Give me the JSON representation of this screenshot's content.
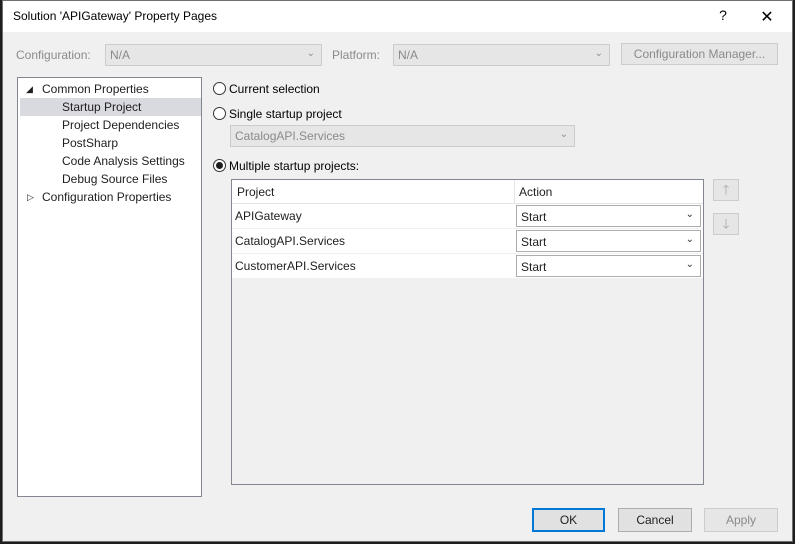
{
  "window": {
    "title": "Solution 'APIGateway' Property Pages",
    "help_glyph": "?",
    "close_glyph": "✕"
  },
  "top_bar": {
    "configuration_label": "Configuration:",
    "configuration_value": "N/A",
    "platform_label": "Platform:",
    "platform_value": "N/A",
    "configuration_manager_label": "Configuration Manager..."
  },
  "tree": {
    "common_properties": "Common Properties",
    "items": [
      "Startup Project",
      "Project Dependencies",
      "PostSharp",
      "Code Analysis Settings",
      "Debug Source Files"
    ],
    "configuration_properties": "Configuration Properties",
    "selected_index": 0
  },
  "startup": {
    "current_selection_label": "Current selection",
    "single_label": "Single startup project",
    "single_value": "CatalogAPI.Services",
    "multiple_label": "Multiple startup projects:",
    "selected_option": "multiple"
  },
  "grid": {
    "columns": [
      "Project",
      "Action"
    ],
    "rows": [
      {
        "project": "APIGateway",
        "action": "Start"
      },
      {
        "project": "CatalogAPI.Services",
        "action": "Start"
      },
      {
        "project": "CustomerAPI.Services",
        "action": "Start"
      }
    ]
  },
  "move_buttons": {
    "up_glyph": "🡑",
    "down_glyph": "🡓"
  },
  "footer": {
    "ok_label": "OK",
    "cancel_label": "Cancel",
    "apply_label": "Apply"
  },
  "icons": {
    "chevron": "⌄",
    "expanded": "◢",
    "collapsed": "▷"
  },
  "colors": {
    "accent": "#0078d7",
    "selection": "#d9d9e0",
    "disabled_text": "#8a8a8a"
  }
}
